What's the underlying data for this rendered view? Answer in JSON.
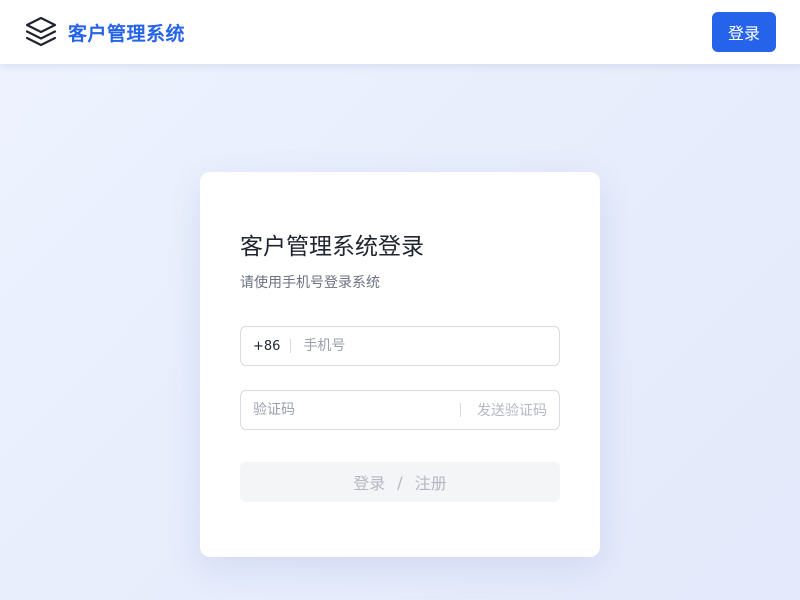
{
  "header": {
    "brand_title": "客户管理系统",
    "login_button": "登录"
  },
  "login_card": {
    "title": "客户管理系统登录",
    "subtitle": "请使用手机号登录系统",
    "phone": {
      "prefix": "+86",
      "placeholder": "手机号",
      "value": ""
    },
    "code": {
      "placeholder": "验证码",
      "value": "",
      "send_label": "发送验证码"
    },
    "submit": {
      "login_label": "登录",
      "separator": "/",
      "register_label": "注册",
      "enabled": false
    }
  },
  "icons": {
    "logo": "layers-icon"
  },
  "colors": {
    "accent": "#2563eb",
    "background": "#eef3ff",
    "card": "#ffffff",
    "disabled_text": "#b3b8c2",
    "disabled_bg": "#f4f5f7"
  }
}
